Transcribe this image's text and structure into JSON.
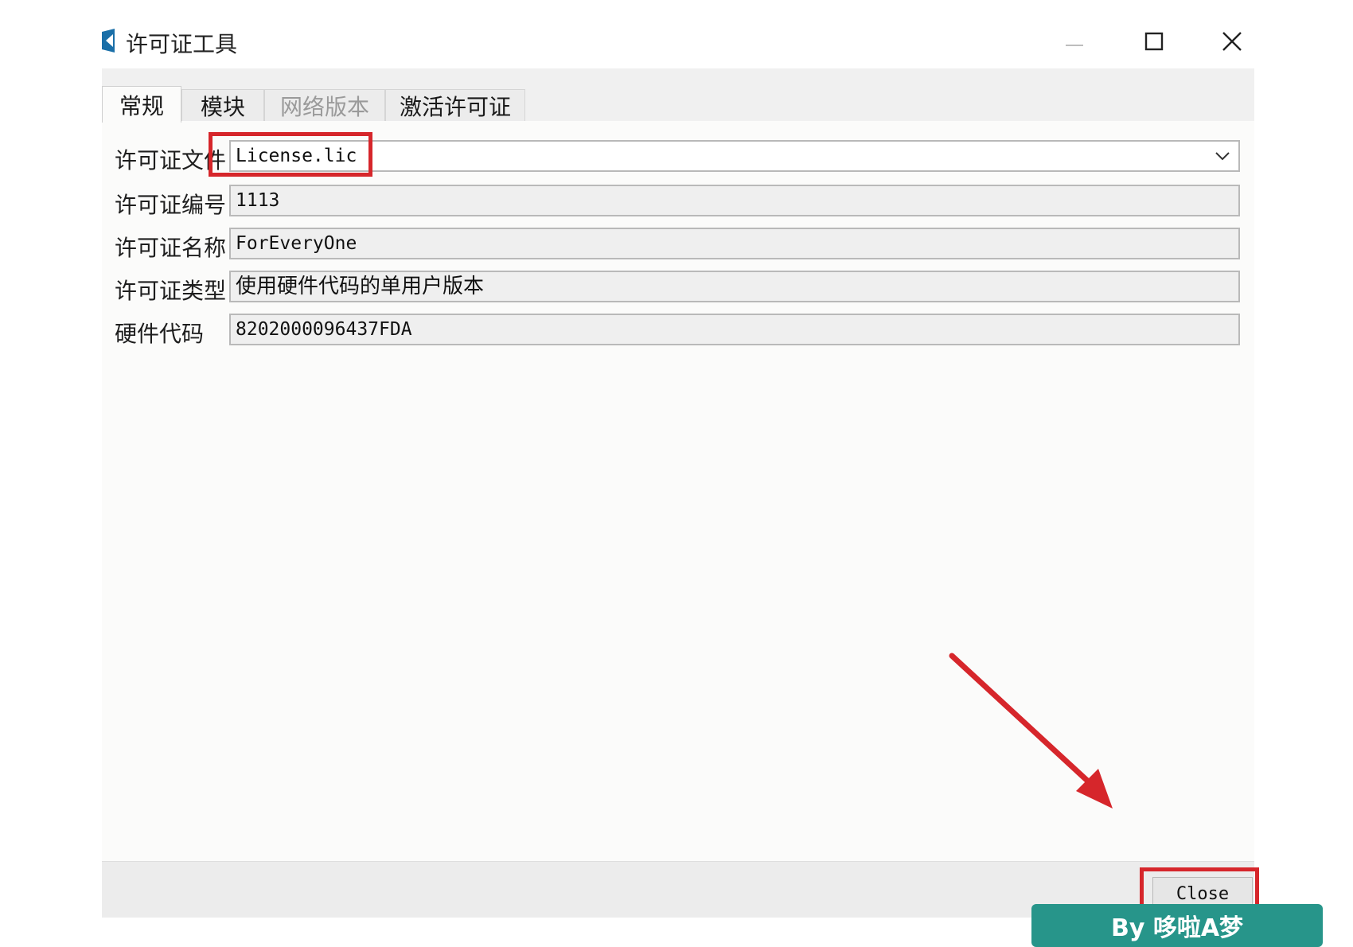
{
  "window": {
    "title": "许可证工具"
  },
  "tabs": [
    {
      "label": "常规",
      "state": "active"
    },
    {
      "label": "模块",
      "state": "normal"
    },
    {
      "label": "网络版本",
      "state": "disabled"
    },
    {
      "label": "激活许可证",
      "state": "normal"
    }
  ],
  "form": {
    "license_file": {
      "label": "许可证文件",
      "value": "License.lic"
    },
    "license_number": {
      "label": "许可证编号",
      "value": "1113"
    },
    "license_name": {
      "label": "许可证名称",
      "value": "ForEveryOne"
    },
    "license_type": {
      "label": "许可证类型",
      "value": "使用硬件代码的单用户版本"
    },
    "hardware_code": {
      "label": "硬件代码",
      "value": "8202000096437FDA"
    }
  },
  "footer": {
    "close_label": "Close"
  },
  "watermark": {
    "text": "By 哆啦A梦"
  },
  "colors": {
    "annotation_red": "#d6262b",
    "watermark_bg": "#27958a",
    "app_icon": "#1a6fa8"
  },
  "icons": {
    "app": "app-logo-icon",
    "minimize": "minimize-icon",
    "maximize": "maximize-icon",
    "close": "close-icon",
    "dropdown": "chevron-down-icon",
    "annotation": "arrow-annotation"
  }
}
